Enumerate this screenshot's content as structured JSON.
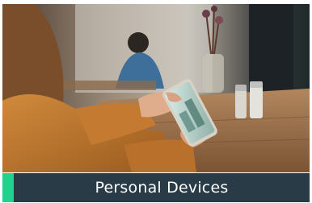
{
  "card": {
    "title": "Personal Devices",
    "image": "person-using-smartphone-in-cafe-photo"
  },
  "colors": {
    "caption_bg": "#283b47",
    "accent": "#1fd38f",
    "caption_text": "#ffffff"
  }
}
